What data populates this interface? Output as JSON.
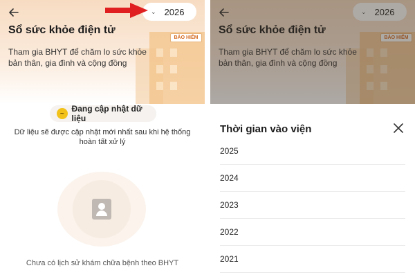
{
  "screen": {
    "page_title": "Sổ sức khỏe điện tử",
    "subtitle": "Tham gia BHYT để chăm lo sức khỏe bản thân, gia đình và cộng đồng",
    "building_sign": "BẢO HIỂM",
    "selected_year": "2026",
    "icons": {
      "back": "arrow-left-icon",
      "year_dropdown": "chevron-down-icon",
      "updating": "sync-icon",
      "empty_state": "user-document-icon",
      "close": "close-icon",
      "annotation": "red-arrow-icon"
    }
  },
  "left": {
    "update_chip_label": "Đang cập nhật dữ liệu",
    "update_description": "Dữ liệu sẽ được cập nhật mới nhất sau khi hệ thống hoàn tất xử lý",
    "empty_text": "Chưa có lịch sử khám chữa bệnh theo BHYT"
  },
  "right": {
    "sheet_title": "Thời gian vào viện",
    "years": [
      "2025",
      "2024",
      "2023",
      "2022",
      "2021"
    ]
  },
  "colors": {
    "annotation_red": "#e02020",
    "accent_yellow": "#f2c21b",
    "hero_peach": "#f7dcc2"
  }
}
